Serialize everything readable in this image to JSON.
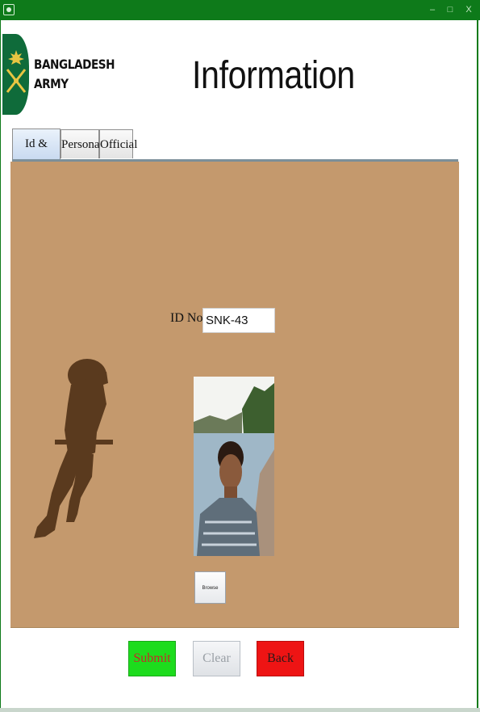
{
  "window": {
    "minimize_glyph": "–",
    "maximize_glyph": "□",
    "close_glyph": "X",
    "accent": "#0e7a1a"
  },
  "header": {
    "logo_line1": "BANGLADESH",
    "logo_line2": "ARMY",
    "title": "Information"
  },
  "tabs": [
    {
      "label": "Id & Image",
      "active": true
    },
    {
      "label": "Personal",
      "active": false
    },
    {
      "label": "Official",
      "active": false
    }
  ],
  "form": {
    "id_label": "ID No.",
    "id_value": "SNK-43",
    "browse_label": "Browse",
    "panel_color": "#c4996d"
  },
  "actions": {
    "submit_label": "Submit",
    "clear_label": "Clear",
    "back_label": "Back"
  }
}
